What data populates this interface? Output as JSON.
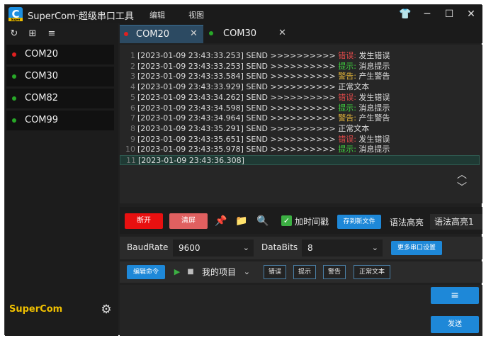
{
  "app": {
    "title": "SuperCom·超级串口工具",
    "logo_letter": "C",
    "logo_sub": "Super"
  },
  "menu": [
    {
      "label": "编辑"
    },
    {
      "label": "视图"
    }
  ],
  "window_controls": {
    "theme": "👕",
    "minimize": "─",
    "maximize": "☐",
    "close": "✕"
  },
  "sidebar": {
    "tools": {
      "refresh": "↻",
      "grid": "⊞",
      "sort": "≡"
    },
    "ports": [
      {
        "label": "COM20",
        "status_color": "#e02020"
      },
      {
        "label": "COM30",
        "status_color": "#28a828"
      },
      {
        "label": "COM82",
        "status_color": "#28a828"
      },
      {
        "label": "COM99",
        "status_color": "#28a828"
      }
    ],
    "brand": "SuperCom",
    "settings_icon": "⚙"
  },
  "tabs": [
    {
      "label": "COM20",
      "status_color": "#e02020",
      "close": "✕",
      "active": true
    },
    {
      "label": "COM30",
      "status_color": "#28a828",
      "close": "✕",
      "active": false
    }
  ],
  "log": {
    "lines": [
      {
        "num": "1",
        "text": "[2023-01-09 23:43:33.253] SEND >>>>>>>>>> ",
        "tag": "错误:",
        "tag_type": "err",
        "msg": " 发生错误"
      },
      {
        "num": "2",
        "text": "[2023-01-09 23:43:33.253] SEND >>>>>>>>>> ",
        "tag": "提示:",
        "tag_type": "info",
        "msg": " 消息提示"
      },
      {
        "num": "3",
        "text": "[2023-01-09 23:43:33.584] SEND >>>>>>>>>> ",
        "tag": "警告:",
        "tag_type": "warn",
        "msg": " 产生警告"
      },
      {
        "num": "4",
        "text": "[2023-01-09 23:43:33.929] SEND >>>>>>>>>> ",
        "tag": "",
        "tag_type": "",
        "msg": "正常文本"
      },
      {
        "num": "5",
        "text": "[2023-01-09 23:43:34.262] SEND >>>>>>>>>> ",
        "tag": "错误:",
        "tag_type": "err",
        "msg": " 发生错误"
      },
      {
        "num": "6",
        "text": "[2023-01-09 23:43:34.598] SEND >>>>>>>>>> ",
        "tag": "提示:",
        "tag_type": "info",
        "msg": " 消息提示"
      },
      {
        "num": "7",
        "text": "[2023-01-09 23:43:34.964] SEND >>>>>>>>>> ",
        "tag": "警告:",
        "tag_type": "warn",
        "msg": " 产生警告"
      },
      {
        "num": "8",
        "text": "[2023-01-09 23:43:35.291] SEND >>>>>>>>>> ",
        "tag": "",
        "tag_type": "",
        "msg": "正常文本"
      },
      {
        "num": "9",
        "text": "[2023-01-09 23:43:35.651] SEND >>>>>>>>>> ",
        "tag": "错误:",
        "tag_type": "err",
        "msg": " 发生错误"
      },
      {
        "num": "10",
        "text": "[2023-01-09 23:43:35.978] SEND >>>>>>>>>> ",
        "tag": "提示:",
        "tag_type": "info",
        "msg": " 消息提示"
      },
      {
        "num": "11",
        "text": "[2023-01-09 23:43:36.308]",
        "tag": "",
        "tag_type": "",
        "msg": ""
      }
    ],
    "scroll_up": "︿",
    "scroll_down": "﹀"
  },
  "toolbar": {
    "disconnect_label": "断开",
    "clear_label": "清屏",
    "pin_icon": "📌",
    "folder_icon": "📁",
    "find_file_icon": "🔍",
    "add_timestamp_checked": "✓",
    "add_timestamp_label": "加时间戳",
    "save_new_file_label": "存到新文件",
    "syntax_label": "语法高亮",
    "syntax_value": "语法高亮1"
  },
  "settings": {
    "baudrate_label": "BaudRate",
    "baudrate_value": "9600",
    "databits_label": "DataBits",
    "databits_value": "8",
    "more_label": "更多串口设置",
    "chevron": "⌄"
  },
  "commands": {
    "edit_label": "编辑命令",
    "run_icon": "▶",
    "stop_icon": "■",
    "project_value": "我的项目",
    "buttons": [
      "错误",
      "提示",
      "警告",
      "正常文本"
    ]
  },
  "send": {
    "send_label": "发送",
    "wrap_icon": "≡"
  }
}
